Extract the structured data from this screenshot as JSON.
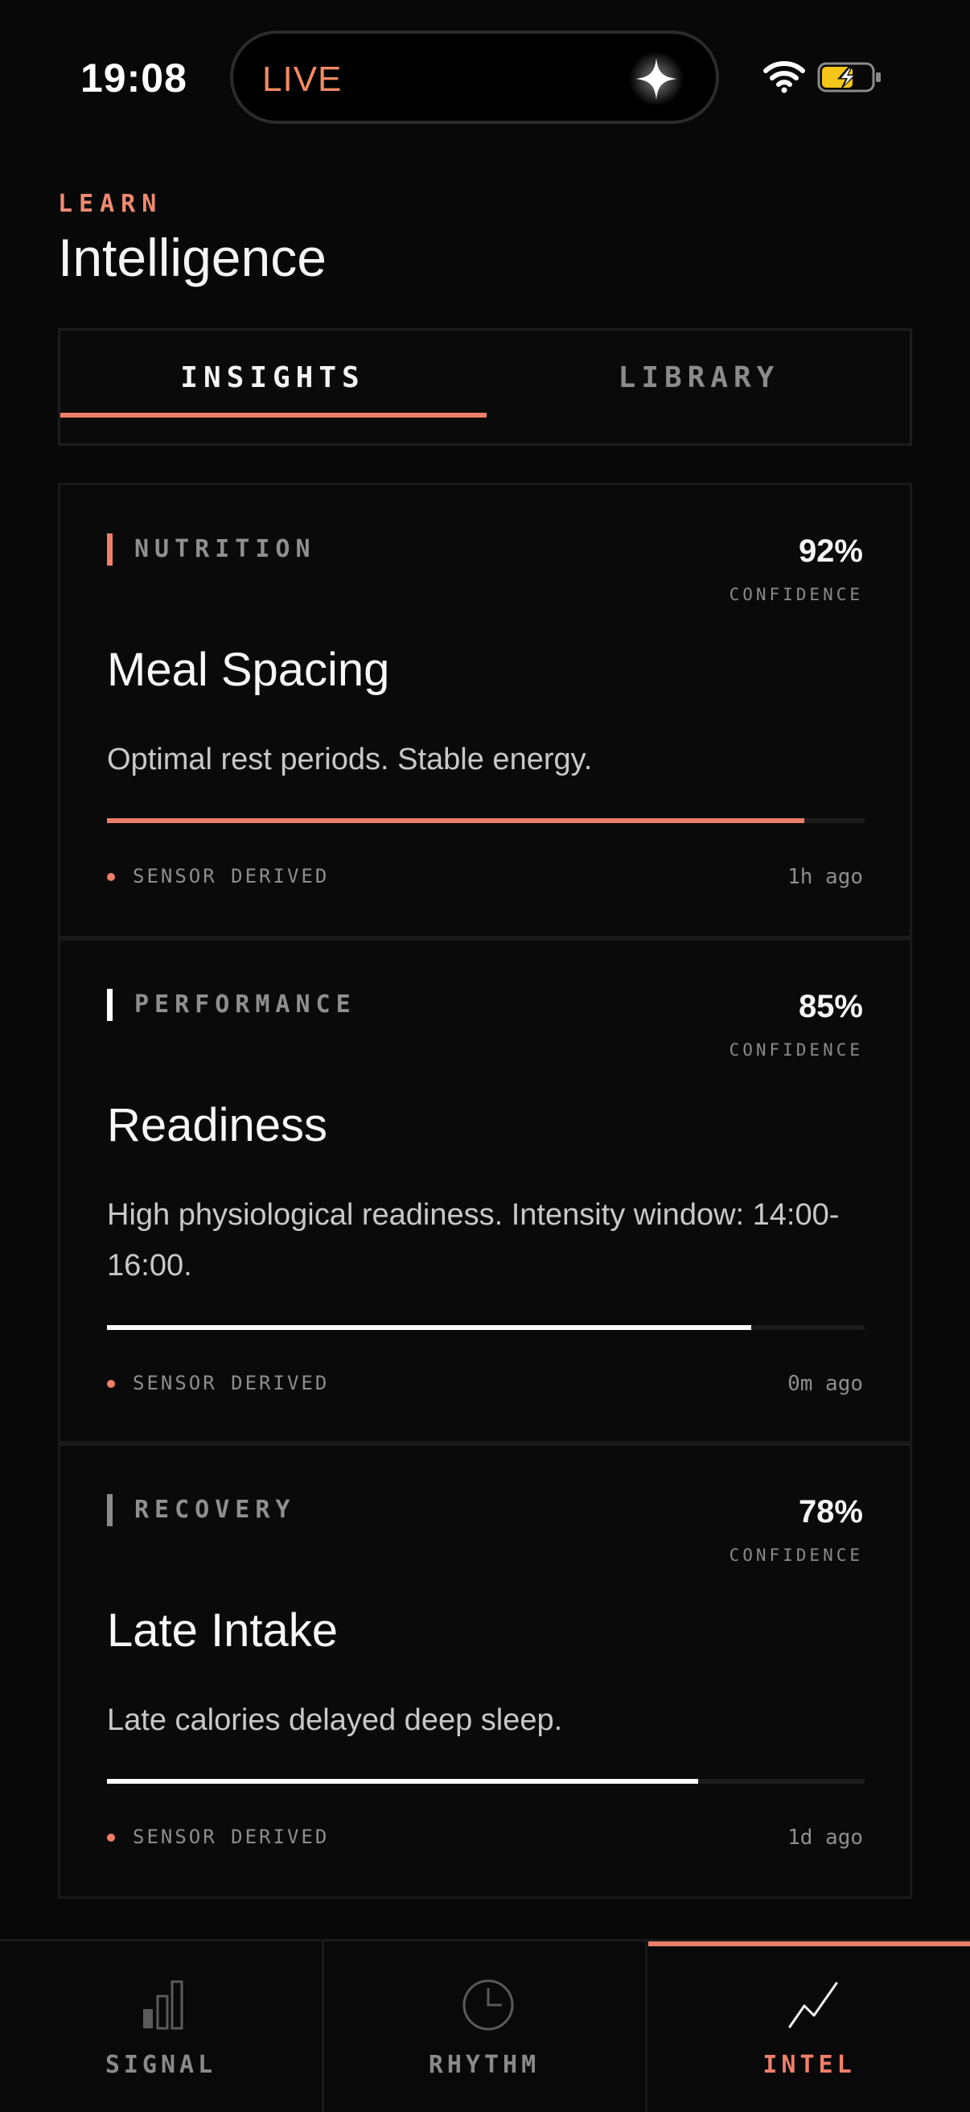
{
  "status_bar": {
    "time": "19:08",
    "island_label": "LIVE",
    "icons": [
      "sparkle-icon",
      "wifi-icon",
      "battery-charging-icon"
    ]
  },
  "header": {
    "eyebrow": "LEARN",
    "title": "Intelligence"
  },
  "tabs": [
    {
      "label": "INSIGHTS",
      "active": true
    },
    {
      "label": "LIBRARY",
      "active": false
    }
  ],
  "cards": [
    {
      "category": "NUTRITION",
      "category_color": "#f07f6a",
      "confidence": "92%",
      "confidence_label": "CONFIDENCE",
      "title": "Meal Spacing",
      "description": "Optimal rest periods. Stable energy.",
      "progress": 0.92,
      "progress_color": "#f07f6a",
      "footer_label": "SENSOR DERIVED",
      "time": "1h ago"
    },
    {
      "category": "PERFORMANCE",
      "category_color": "#ffffff",
      "confidence": "85%",
      "confidence_label": "CONFIDENCE",
      "title": "Readiness",
      "description": "High physiological readiness. Intensity window: 14:00-16:00.",
      "progress": 0.85,
      "progress_color": "#ffffff",
      "footer_label": "SENSOR DERIVED",
      "time": "0m ago"
    },
    {
      "category": "RECOVERY",
      "category_color": "#8a8a8a",
      "confidence": "78%",
      "confidence_label": "CONFIDENCE",
      "title": "Late Intake",
      "description": "Late calories delayed deep sleep.",
      "progress": 0.78,
      "progress_color": "#ffffff",
      "footer_label": "SENSOR DERIVED",
      "time": "1d ago"
    }
  ],
  "bottom_nav": [
    {
      "label": "SIGNAL",
      "icon": "signal-bars-icon",
      "active": false
    },
    {
      "label": "RHYTHM",
      "icon": "clock-icon",
      "active": false
    },
    {
      "label": "INTEL",
      "icon": "trend-line-icon",
      "active": true
    }
  ],
  "colors": {
    "accent": "#f07f6a",
    "background": "#080808",
    "battery": "#f5c518"
  }
}
